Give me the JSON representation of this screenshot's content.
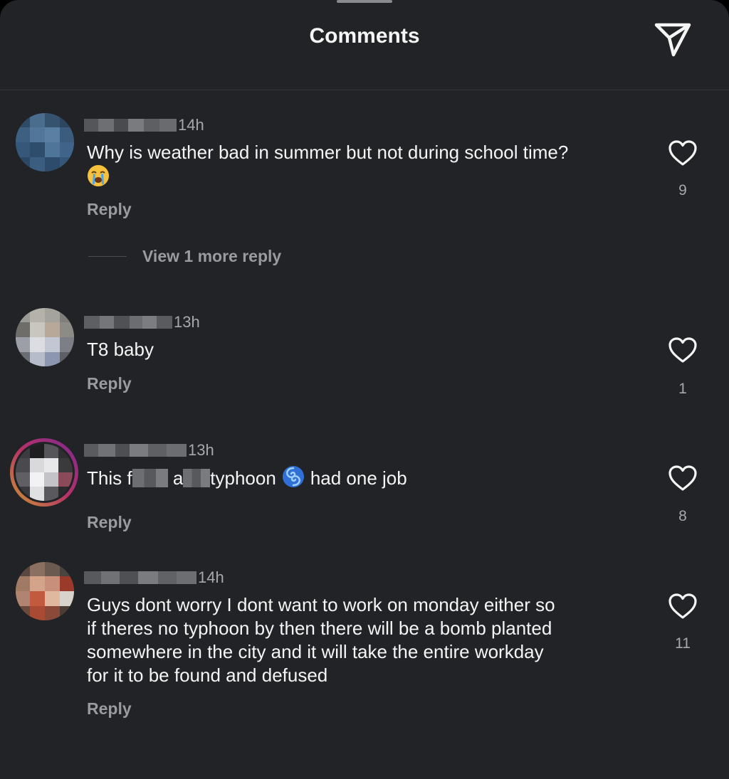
{
  "header": {
    "title": "Comments",
    "share_icon": "send-paper-plane-icon"
  },
  "colors": {
    "background": "#222326",
    "text_primary": "#f5f5f5",
    "text_secondary": "#a8a8ab",
    "like_outline": "#f5f5f5"
  },
  "comments": [
    {
      "username": "",
      "timestamp": "14h",
      "text": "Why is weather bad in summer but not during school time?",
      "emoji": "loudly-crying-face",
      "reply_label": "Reply",
      "likes": "9",
      "view_replies_label": "View 1 more reply"
    },
    {
      "username": "",
      "timestamp": "13h",
      "text": "T8 baby",
      "reply_label": "Reply",
      "likes": "1"
    },
    {
      "username": "",
      "timestamp": "13h",
      "text_parts": [
        "This f",
        "a",
        "typhoon",
        "had one job"
      ],
      "emoji": "cyclone",
      "reply_label": "Reply",
      "likes": "8"
    },
    {
      "username": "",
      "timestamp": "14h",
      "text": "Guys dont worry I dont want to work on monday either so\nif theres no typhoon by then there will be a bomb planted\nsomewhere in the city and it will take the entire workday\nfor it to be found and defused",
      "reply_label": "Reply",
      "likes": "11"
    }
  ]
}
